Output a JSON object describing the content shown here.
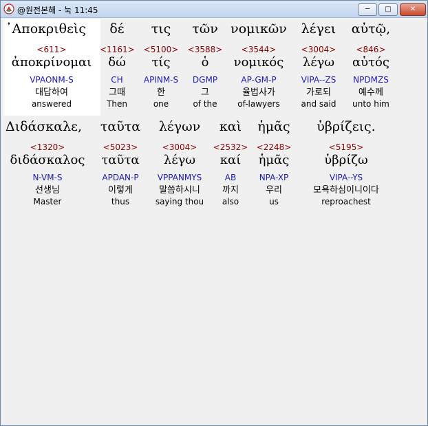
{
  "window": {
    "title": "@원전본해 - 눅 11:45",
    "min_label": "─",
    "max_label": "□",
    "close_label": "✕"
  },
  "rows": [
    {
      "words": [
        {
          "greek": "᾿Αποκριθεὶς",
          "strong": "<611>",
          "lemma": "ἀποκρίνομαι",
          "morph": "VPAONM-S",
          "kor": "대답하여",
          "eng": "answered"
        },
        {
          "greek": "δέ",
          "strong": "<1161>",
          "lemma": "δώ",
          "morph": "CH",
          "kor": "그때",
          "eng": "Then"
        },
        {
          "greek": "τις",
          "strong": "<5100>",
          "lemma": "τίς",
          "morph": "APINM-S",
          "kor": "한",
          "eng": "one"
        },
        {
          "greek": "τῶν",
          "strong": "<3588>",
          "lemma": "ὁ",
          "morph": "DGMP",
          "kor": "그",
          "eng": "of the"
        },
        {
          "greek": "νομικῶν",
          "strong": "<3544>",
          "lemma": "νομικός",
          "morph": "AP-GM-P",
          "kor": "율법사가",
          "eng": "of-lawyers"
        },
        {
          "greek": "λέγει",
          "strong": "<3004>",
          "lemma": "λέγω",
          "morph": "VIPA--ZS",
          "kor": "가로되",
          "eng": "and said"
        },
        {
          "greek": "αὐτῷ,",
          "strong": "<846>",
          "lemma": "αὐτός",
          "morph": "NPDMZS",
          "kor": "예수께",
          "eng": "unto him"
        }
      ]
    },
    {
      "words": [
        {
          "greek": "Διδάσκαλε,",
          "strong": "<1320>",
          "lemma": "διδάσκαλος",
          "morph": "N-VM-S",
          "kor": "선생님",
          "eng": "Master"
        },
        {
          "greek": "ταῦτα",
          "strong": "<5023>",
          "lemma": "ταῦτα",
          "morph": "APDAN-P",
          "kor": "이렇게",
          "eng": "thus"
        },
        {
          "greek": "λέγων",
          "strong": "<3004>",
          "lemma": "λέγω",
          "morph": "VPPANMYS",
          "kor": "말씀하시니",
          "eng": "saying thou"
        },
        {
          "greek": "καὶ",
          "strong": "<2532>",
          "lemma": "καί",
          "morph": "AB",
          "kor": "까지",
          "eng": "also"
        },
        {
          "greek": "ἡμᾶς",
          "strong": "<2248>",
          "lemma": "ἡμᾶς",
          "morph": "NPA-XP",
          "kor": "우리",
          "eng": "us"
        },
        {
          "greek": "ὑβρίζεις.",
          "strong": "<5195>",
          "lemma": "ὑβρίζω",
          "morph": "VIPA--YS",
          "kor": "모욕하심이니이다",
          "eng": "reproachest"
        }
      ]
    }
  ]
}
